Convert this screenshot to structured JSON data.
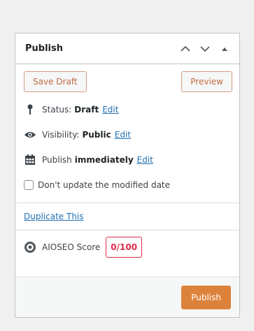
{
  "panel": {
    "title": "Publish",
    "header_icons": [
      "chevron-up-icon",
      "chevron-down-icon",
      "triangle-up-icon"
    ]
  },
  "actions": {
    "save_draft": "Save Draft",
    "preview": "Preview"
  },
  "status": {
    "label": "Status:",
    "value": "Draft",
    "edit": "Edit",
    "icon": "pin-icon"
  },
  "visibility": {
    "label": "Visibility:",
    "value": "Public",
    "edit": "Edit",
    "icon": "eye-icon"
  },
  "schedule": {
    "label": "Publish",
    "value": "immediately",
    "edit": "Edit",
    "icon": "calendar-icon"
  },
  "modified_date": {
    "label": "Don't update the modified date",
    "checked": false
  },
  "duplicate": {
    "label": "Duplicate This"
  },
  "aioseo": {
    "label": "AIOSEO Score",
    "score": "0/100",
    "icon": "aioseo-logo-icon"
  },
  "footer": {
    "publish": "Publish"
  },
  "colors": {
    "accent": "#dd823b",
    "link": "#2271b1",
    "score": "#df2a4a"
  }
}
